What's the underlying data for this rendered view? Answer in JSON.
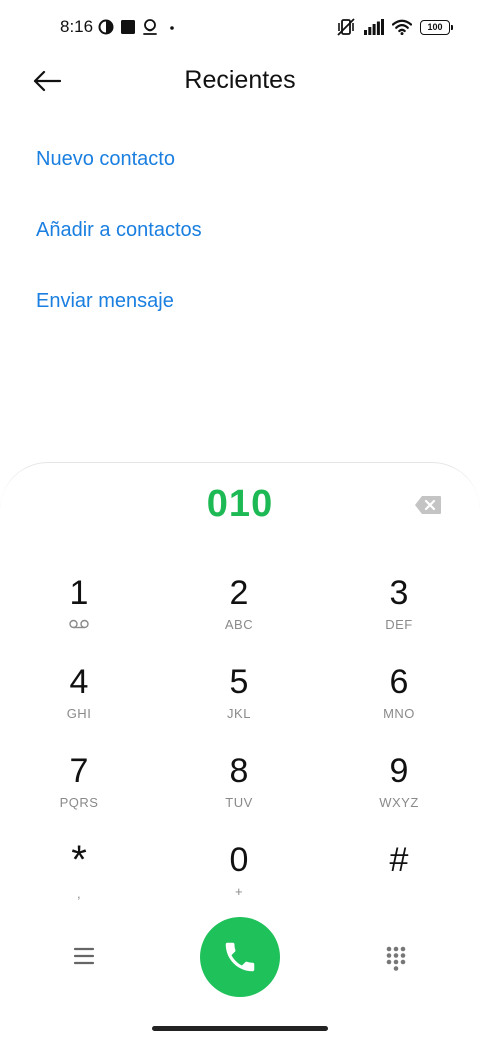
{
  "status_bar": {
    "time": "8:16",
    "battery_level": "100",
    "left_icons": [
      "data-saver-icon",
      "square-notification-icon",
      "account-icon",
      "dot-icon"
    ],
    "right_icons": [
      "vibrate-off-icon",
      "signal-icon",
      "wifi-icon",
      "battery-icon"
    ]
  },
  "header": {
    "title": "Recientes"
  },
  "menu": {
    "items": [
      {
        "label": "Nuevo contacto"
      },
      {
        "label": "Añadir a contactos"
      },
      {
        "label": "Enviar mensaje"
      }
    ]
  },
  "dialpad": {
    "number": "010",
    "keys": [
      {
        "digit": "1",
        "letters": ""
      },
      {
        "digit": "2",
        "letters": "ABC"
      },
      {
        "digit": "3",
        "letters": "DEF"
      },
      {
        "digit": "4",
        "letters": "GHI"
      },
      {
        "digit": "5",
        "letters": "JKL"
      },
      {
        "digit": "6",
        "letters": "MNO"
      },
      {
        "digit": "7",
        "letters": "PQRS"
      },
      {
        "digit": "8",
        "letters": "TUV"
      },
      {
        "digit": "9",
        "letters": "WXYZ"
      },
      {
        "digit": "*",
        "letters": ","
      },
      {
        "digit": "0",
        "letters": "+"
      },
      {
        "digit": "#",
        "letters": ""
      }
    ]
  },
  "colors": {
    "accent_blue": "#1a7fe0",
    "number_green": "#1db954",
    "call_green": "#1fc15b"
  }
}
